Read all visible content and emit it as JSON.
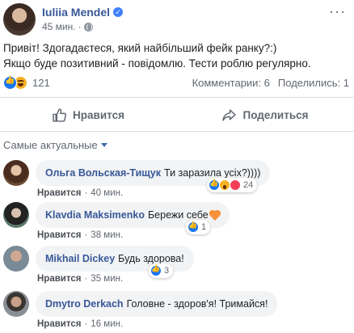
{
  "post": {
    "author": "Iuliia Mendel",
    "verified_mark": "✓",
    "time": "45 мин.",
    "more_label": "···",
    "text_line1": "Привіт! Здогадаєтеся, який найбільший фейк ранку?:)",
    "text_line2": "Якщо буде позитивний - повідомлю. Тести роблю регулярно.",
    "reactions_count": "121",
    "comments_label": "Комментарии: 6",
    "shares_label": "Поделились: 1"
  },
  "actions": {
    "like_label": "Нравится",
    "share_label": "Поделиться"
  },
  "sort": {
    "label": "Самые актуальные"
  },
  "comments": [
    {
      "name": "Ольга Вольская-Тищук",
      "text": "Ти заразила усіх?))))",
      "like_label": "Нравится",
      "sep": "·",
      "time": "40 мин.",
      "reactions": "24",
      "reaction_icons": [
        "like",
        "wow",
        "love"
      ]
    },
    {
      "name": "Klavdia Maksimenko",
      "text": "Бережи себе",
      "like_label": "Нравится",
      "sep": "·",
      "time": "38 мин.",
      "reactions": "1",
      "reaction_icons": [
        "like"
      ],
      "emoji": "orange-heart"
    },
    {
      "name": "Mikhail Dickey",
      "text": "Будь здорова!",
      "like_label": "Нравится",
      "sep": "·",
      "time": "35 мин.",
      "reactions": "3",
      "reaction_icons": [
        "like"
      ]
    },
    {
      "name": "Dmytro Derkach",
      "text": "Головне - здоров'я! Тримайся!",
      "like_label": "Нравится",
      "sep": "·",
      "time": "16 мин."
    }
  ],
  "colors": {
    "link_blue": "#385898",
    "fb_blue": "#1877f2",
    "meta_gray": "#616770",
    "bubble_bg": "#f2f3f5"
  }
}
